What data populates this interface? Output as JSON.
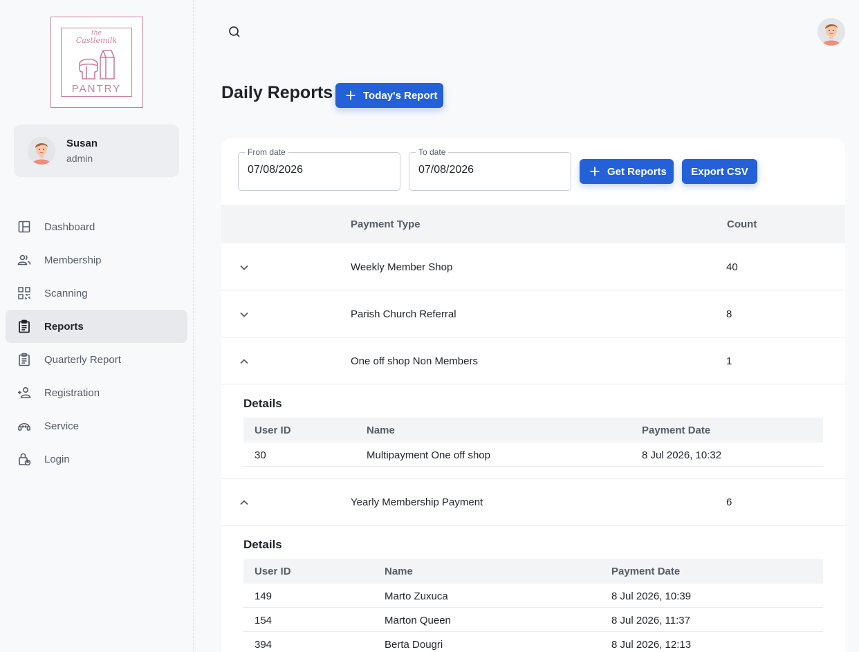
{
  "logo": {
    "line1": "the",
    "line2": "Castlemilk",
    "line3": "PANTRY"
  },
  "user": {
    "name": "Susan",
    "role": "admin"
  },
  "nav": [
    {
      "label": "Dashboard",
      "icon": "dashboard-icon"
    },
    {
      "label": "Membership",
      "icon": "people-icon"
    },
    {
      "label": "Scanning",
      "icon": "qr-scan-icon"
    },
    {
      "label": "Reports",
      "icon": "clipboard-icon",
      "active": true
    },
    {
      "label": "Quarterly Report",
      "icon": "clipboard-list-icon"
    },
    {
      "label": "Registration",
      "icon": "person-add-icon"
    },
    {
      "label": "Service",
      "icon": "support-icon"
    },
    {
      "label": "Login",
      "icon": "lock-person-icon"
    }
  ],
  "page": {
    "title": "Daily Reports",
    "today_button": "Today's Report"
  },
  "filters": {
    "from_label": "From date",
    "from_value": "07/08/2026",
    "to_label": "To date",
    "to_value": "07/08/2026",
    "get_button": "Get Reports",
    "export_button": "Export CSV"
  },
  "table": {
    "headers": {
      "payment_type": "Payment Type",
      "count": "Count"
    },
    "rows": [
      {
        "type": "Weekly Member Shop",
        "count": "40",
        "expanded": false
      },
      {
        "type": "Parish Church Referral",
        "count": "8",
        "expanded": false
      },
      {
        "type": "One off shop Non Members",
        "count": "1",
        "expanded": true
      },
      {
        "type": "Yearly Membership Payment",
        "count": "6",
        "expanded": true
      }
    ]
  },
  "details1": {
    "title": "Details",
    "headers": {
      "user_id": "User ID",
      "name": "Name",
      "date": "Payment Date"
    },
    "rows": [
      {
        "user_id": "30",
        "name": "Multipayment One off shop",
        "date": "8 Jul 2026, 10:32"
      }
    ]
  },
  "details2": {
    "title": "Details",
    "headers": {
      "user_id": "User ID",
      "name": "Name",
      "date": "Payment Date"
    },
    "rows": [
      {
        "user_id": "149",
        "name": "Marto Zuxuca",
        "date": "8 Jul 2026, 10:39"
      },
      {
        "user_id": "154",
        "name": "Marton Queen",
        "date": "8 Jul 2026, 11:37"
      },
      {
        "user_id": "394",
        "name": "Berta Dougri",
        "date": "8 Jul 2026, 12:13"
      }
    ]
  },
  "colors": {
    "accent": "#2461d9",
    "logo": "#c97f99"
  }
}
